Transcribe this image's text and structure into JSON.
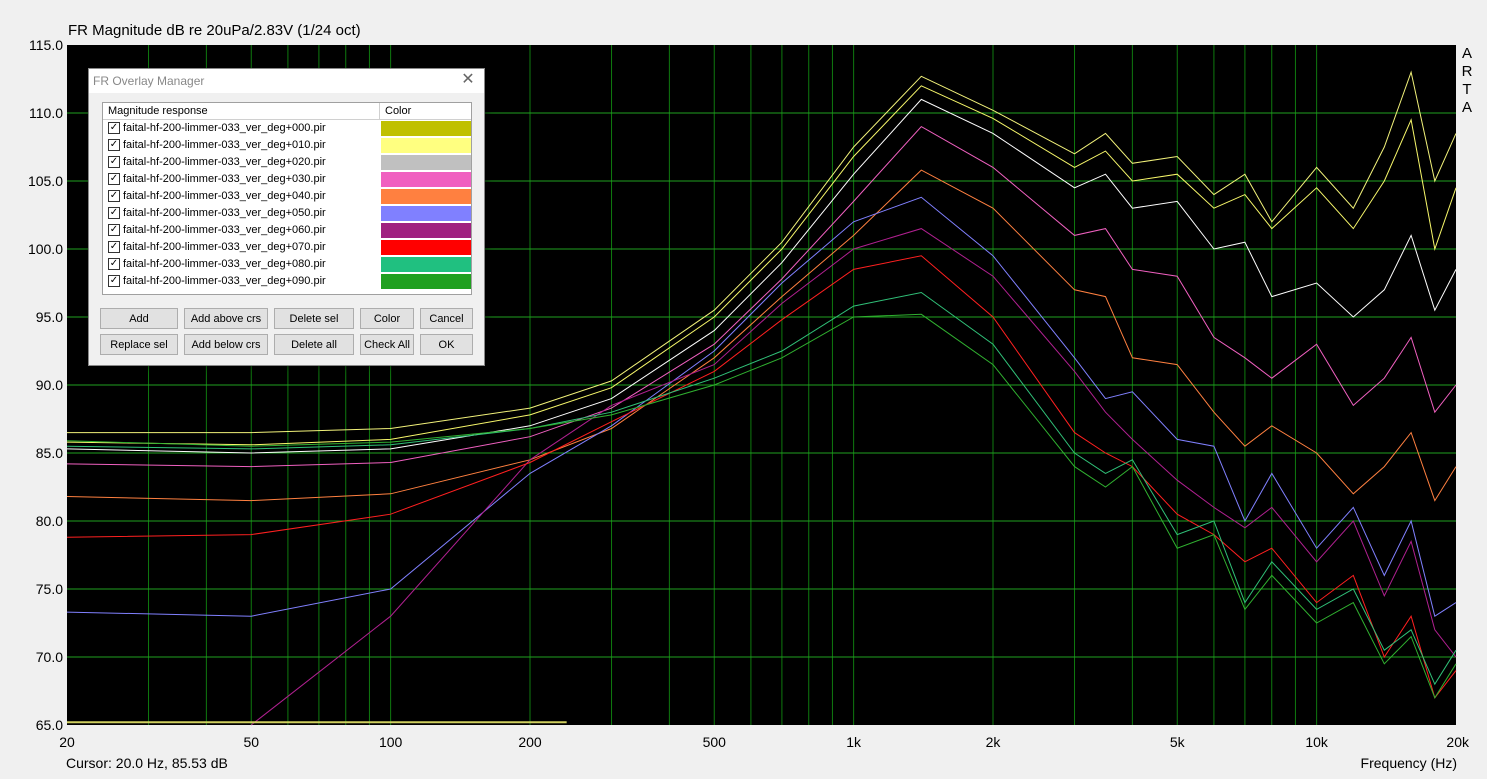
{
  "chart_title": "FR Magnitude dB re 20uPa/2.83V (1/24 oct)",
  "brand_letters": [
    "A",
    "R",
    "T",
    "A"
  ],
  "cursor_readout": "Cursor: 20.0 Hz, 85.53 dB",
  "x_axis_label": "Frequency (Hz)",
  "chart_data": {
    "type": "line",
    "title": "FR Magnitude dB re 20uPa/2.83V (1/24 oct)",
    "xlabel": "Frequency (Hz)",
    "ylabel": "",
    "xscale": "log",
    "xlim": [
      20,
      20000
    ],
    "ylim": [
      65,
      115
    ],
    "grid": true,
    "ytick_labels": [
      "115.0",
      "110.0",
      "105.0",
      "100.0",
      "95.0",
      "90.0",
      "85.0",
      "80.0",
      "75.0",
      "70.0",
      "65.0"
    ],
    "xtick_labels": [
      {
        "v": 20,
        "t": "20"
      },
      {
        "v": 50,
        "t": "50"
      },
      {
        "v": 100,
        "t": "100"
      },
      {
        "v": 200,
        "t": "200"
      },
      {
        "v": 500,
        "t": "500"
      },
      {
        "v": 1000,
        "t": "1k"
      },
      {
        "v": 2000,
        "t": "2k"
      },
      {
        "v": 5000,
        "t": "5k"
      },
      {
        "v": 10000,
        "t": "10k"
      },
      {
        "v": 20000,
        "t": "20k"
      }
    ],
    "series": [
      {
        "name": "faital-hf-200-limmer-033_ver_deg+000.pir",
        "color": "#f2f27a",
        "x": [
          20,
          50,
          100,
          200,
          300,
          500,
          700,
          1000,
          1400,
          2000,
          3000,
          3500,
          4000,
          5000,
          6000,
          7000,
          8000,
          10000,
          12000,
          14000,
          16000,
          18000,
          20000
        ],
        "y": [
          86.5,
          86.5,
          86.8,
          88.3,
          90.3,
          95.5,
          100.5,
          107.5,
          112.7,
          110.2,
          107.0,
          108.5,
          106.3,
          106.8,
          104.0,
          105.5,
          102.0,
          106.0,
          103.0,
          107.5,
          113.0,
          105.0,
          108.5
        ]
      },
      {
        "name": "faital-hf-200-limmer-033_ver_deg+010.pir",
        "color": "#f7f76a",
        "x": [
          20,
          50,
          100,
          200,
          300,
          500,
          700,
          1000,
          1400,
          2000,
          3000,
          3500,
          4000,
          5000,
          6000,
          7000,
          8000,
          10000,
          12000,
          14000,
          16000,
          18000,
          20000
        ],
        "y": [
          85.8,
          85.6,
          86.0,
          87.8,
          89.8,
          95.0,
          100.0,
          106.8,
          112.0,
          109.6,
          106.0,
          107.2,
          105.0,
          105.5,
          103.0,
          104.0,
          101.5,
          104.5,
          101.5,
          105.0,
          109.5,
          100.0,
          104.5
        ]
      },
      {
        "name": "faital-hf-200-limmer-033_ver_deg+020.pir",
        "color": "#ffffff",
        "x": [
          20,
          50,
          100,
          200,
          300,
          500,
          700,
          1000,
          1400,
          2000,
          3000,
          3500,
          4000,
          5000,
          6000,
          7000,
          8000,
          10000,
          12000,
          14000,
          16000,
          18000,
          20000
        ],
        "y": [
          85.3,
          85.0,
          85.3,
          87.0,
          89.0,
          94.0,
          99.0,
          105.5,
          111.0,
          108.5,
          104.5,
          105.5,
          103.0,
          103.5,
          100.0,
          100.5,
          96.5,
          97.5,
          95.0,
          97.0,
          101.0,
          95.5,
          98.5
        ]
      },
      {
        "name": "faital-hf-200-limmer-033_ver_deg+030.pir",
        "color": "#f060c0",
        "x": [
          20,
          50,
          100,
          200,
          300,
          500,
          700,
          1000,
          1400,
          2000,
          3000,
          3500,
          4000,
          5000,
          6000,
          7000,
          8000,
          10000,
          12000,
          14000,
          16000,
          18000,
          20000
        ],
        "y": [
          84.2,
          84.0,
          84.3,
          86.2,
          88.3,
          93.0,
          97.8,
          103.5,
          109.0,
          106.0,
          101.0,
          101.5,
          98.5,
          98.0,
          93.5,
          92.0,
          90.5,
          93.0,
          88.5,
          90.5,
          93.5,
          88.0,
          90.0
        ]
      },
      {
        "name": "faital-hf-200-limmer-033_ver_deg+040.pir",
        "color": "#ff8040",
        "x": [
          20,
          50,
          100,
          200,
          300,
          500,
          700,
          1000,
          1400,
          2000,
          3000,
          3500,
          4000,
          5000,
          6000,
          7000,
          8000,
          10000,
          12000,
          14000,
          16000,
          18000,
          20000
        ],
        "y": [
          81.8,
          81.5,
          82.0,
          84.5,
          86.8,
          92.0,
          96.5,
          101.0,
          105.8,
          103.0,
          97.0,
          96.5,
          92.0,
          91.5,
          88.0,
          85.5,
          87.0,
          85.0,
          82.0,
          84.0,
          86.5,
          81.5,
          84.0
        ]
      },
      {
        "name": "faital-hf-200-limmer-033_ver_deg+050.pir",
        "color": "#8080ff",
        "x": [
          20,
          50,
          100,
          200,
          300,
          500,
          700,
          1000,
          1400,
          2000,
          3000,
          3500,
          4000,
          5000,
          6000,
          7000,
          8000,
          10000,
          12000,
          14000,
          16000,
          18000,
          20000
        ],
        "y": [
          73.3,
          73.0,
          75.0,
          83.5,
          87.0,
          92.5,
          97.5,
          102.0,
          103.8,
          99.5,
          92.0,
          89.0,
          89.5,
          86.0,
          85.5,
          80.0,
          83.5,
          78.0,
          81.0,
          76.0,
          80.0,
          73.0,
          74.0
        ]
      },
      {
        "name": "faital-hf-200-limmer-033_ver_deg+060.pir",
        "color": "#b02090",
        "x": [
          50,
          100,
          200,
          300,
          500,
          700,
          1000,
          1400,
          2000,
          3000,
          3500,
          4000,
          5000,
          6000,
          7000,
          8000,
          10000,
          12000,
          14000,
          16000,
          18000,
          20000
        ],
        "y": [
          65.0,
          73.0,
          84.5,
          88.5,
          91.5,
          96.0,
          100.0,
          101.5,
          98.0,
          91.0,
          88.0,
          86.0,
          83.0,
          81.0,
          79.5,
          81.0,
          77.0,
          80.0,
          74.5,
          78.5,
          72.0,
          70.0
        ]
      },
      {
        "name": "faital-hf-200-limmer-033_ver_deg+070.pir",
        "color": "#ff2020",
        "x": [
          20,
          50,
          100,
          200,
          300,
          500,
          700,
          1000,
          1400,
          2000,
          3000,
          3500,
          4000,
          5000,
          6000,
          7000,
          8000,
          10000,
          12000,
          14000,
          16000,
          18000,
          20000
        ],
        "y": [
          78.8,
          79.0,
          80.5,
          84.3,
          87.3,
          91.0,
          94.8,
          98.5,
          99.5,
          95.0,
          86.5,
          85.0,
          84.0,
          80.5,
          79.0,
          77.0,
          78.0,
          74.0,
          76.0,
          70.0,
          73.0,
          67.0,
          69.0
        ]
      },
      {
        "name": "faital-hf-200-limmer-033_ver_deg+080.pir",
        "color": "#30c078",
        "x": [
          20,
          50,
          100,
          200,
          300,
          500,
          700,
          1000,
          1400,
          2000,
          3000,
          3500,
          4000,
          5000,
          6000,
          7000,
          8000,
          10000,
          12000,
          14000,
          16000,
          18000,
          20000
        ],
        "y": [
          85.5,
          85.3,
          85.6,
          86.8,
          88.0,
          90.5,
          92.5,
          95.8,
          96.8,
          93.0,
          85.0,
          83.5,
          84.5,
          79.0,
          80.0,
          74.0,
          77.0,
          73.5,
          75.0,
          70.5,
          72.0,
          68.0,
          70.5
        ]
      },
      {
        "name": "faital-hf-200-limmer-033_ver_deg+090.pir",
        "color": "#30b030",
        "x": [
          20,
          50,
          100,
          200,
          300,
          500,
          700,
          1000,
          1400,
          2000,
          3000,
          3500,
          4000,
          5000,
          6000,
          7000,
          8000,
          10000,
          12000,
          14000,
          16000,
          18000,
          20000
        ],
        "y": [
          85.9,
          85.5,
          85.8,
          86.8,
          87.8,
          90.0,
          92.0,
          95.0,
          95.2,
          91.5,
          84.0,
          82.5,
          84.0,
          78.0,
          79.0,
          73.5,
          76.0,
          72.5,
          74.0,
          69.5,
          71.5,
          67.0,
          69.5
        ]
      }
    ],
    "annotations": [
      {
        "type": "hline",
        "y": 65.2,
        "x_from": 20,
        "x_to": 240,
        "color": "#d0d060"
      }
    ]
  },
  "dialog": {
    "title": "FR Overlay Manager",
    "close_glyph": "✕",
    "header_magnitude": "Magnitude response",
    "header_color": "Color",
    "check_glyph": "✓",
    "items": [
      {
        "label": "faital-hf-200-limmer-033_ver_deg+000.pir",
        "color": "#c0c000",
        "checked": true
      },
      {
        "label": "faital-hf-200-limmer-033_ver_deg+010.pir",
        "color": "#ffff80",
        "checked": true
      },
      {
        "label": "faital-hf-200-limmer-033_ver_deg+020.pir",
        "color": "#c0c0c0",
        "checked": true
      },
      {
        "label": "faital-hf-200-limmer-033_ver_deg+030.pir",
        "color": "#f060c0",
        "checked": true
      },
      {
        "label": "faital-hf-200-limmer-033_ver_deg+040.pir",
        "color": "#ff8040",
        "checked": true
      },
      {
        "label": "faital-hf-200-limmer-033_ver_deg+050.pir",
        "color": "#8080ff",
        "checked": true
      },
      {
        "label": "faital-hf-200-limmer-033_ver_deg+060.pir",
        "color": "#a02080",
        "checked": true
      },
      {
        "label": "faital-hf-200-limmer-033_ver_deg+070.pir",
        "color": "#ff0000",
        "checked": true
      },
      {
        "label": "faital-hf-200-limmer-033_ver_deg+080.pir",
        "color": "#20c080",
        "checked": true
      },
      {
        "label": "faital-hf-200-limmer-033_ver_deg+090.pir",
        "color": "#20a020",
        "checked": true
      }
    ],
    "buttons": {
      "add": "Add",
      "add_above": "Add above crs",
      "delete_sel": "Delete sel",
      "color": "Color",
      "cancel": "Cancel",
      "replace_sel": "Replace sel",
      "add_below": "Add below crs",
      "delete_all": "Delete all",
      "check_all": "Check All",
      "ok": "OK"
    }
  }
}
